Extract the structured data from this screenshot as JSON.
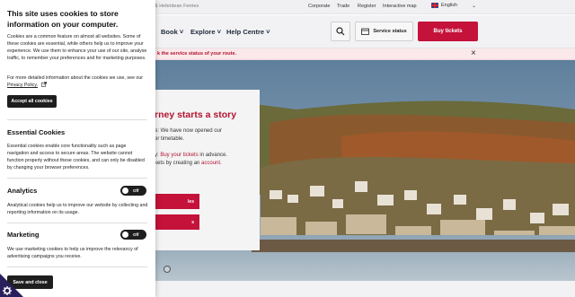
{
  "site": {
    "brand_text": "& Hebridean Ferries",
    "utility_links": [
      "Corporate",
      "Trade",
      "Register",
      "Interactive map"
    ],
    "language": "English",
    "nav_items": [
      {
        "label": "Book"
      },
      {
        "label": "Explore"
      },
      {
        "label": "Help Centre"
      }
    ],
    "service_status_label": "Service status",
    "buy_tickets_label": "Buy tickets",
    "alert_text": "k the service status of your route.",
    "hero_card": {
      "title": "rney starts a story",
      "line1": "e: We have now opened our",
      "line2": "er timetable.",
      "line3_prefix": "y: ",
      "line3_link": "Buy your tickets",
      "line3_suffix": " in advance.",
      "line4_prefix": "kets by creating an ",
      "line4_link": "account",
      "line4_suffix": ".",
      "button1": "les",
      "button2": "s"
    }
  },
  "cookie_panel": {
    "title": "This site uses cookies to store information on your computer.",
    "intro": "Cookies are a common feature on almost all websites. Some of these cookies are essential, while others help us to improve your experience. We use them to enhance your use of our site, analyse traffic, to remember your preferences and for marketing purposes.",
    "more_info_text": "For more detailed information about the cookies we use, see our",
    "privacy_link": "Privacy Policy.",
    "accept_all": "Accept all cookies",
    "essential": {
      "heading": "Essential Cookies",
      "text": "Essential cookies enable core functionality such as page navigation and access to secure areas. The website cannot function properly without these cookies, and can only be disabled by changing your browser preferences."
    },
    "analytics": {
      "heading": "Analytics",
      "toggle_state": "Off",
      "text": "Analytical cookies help us to improve our website by collecting and reporting information on its usage."
    },
    "marketing": {
      "heading": "Marketing",
      "toggle_state": "Off",
      "text": "We use marketing cookies to help us improve the relevancy of advertising campaigns you receive."
    },
    "save_and_close": "Save and close"
  },
  "colors": {
    "accent": "#c4123a",
    "dark": "#1e1e1e",
    "alert_bg": "#fbe8ea"
  }
}
